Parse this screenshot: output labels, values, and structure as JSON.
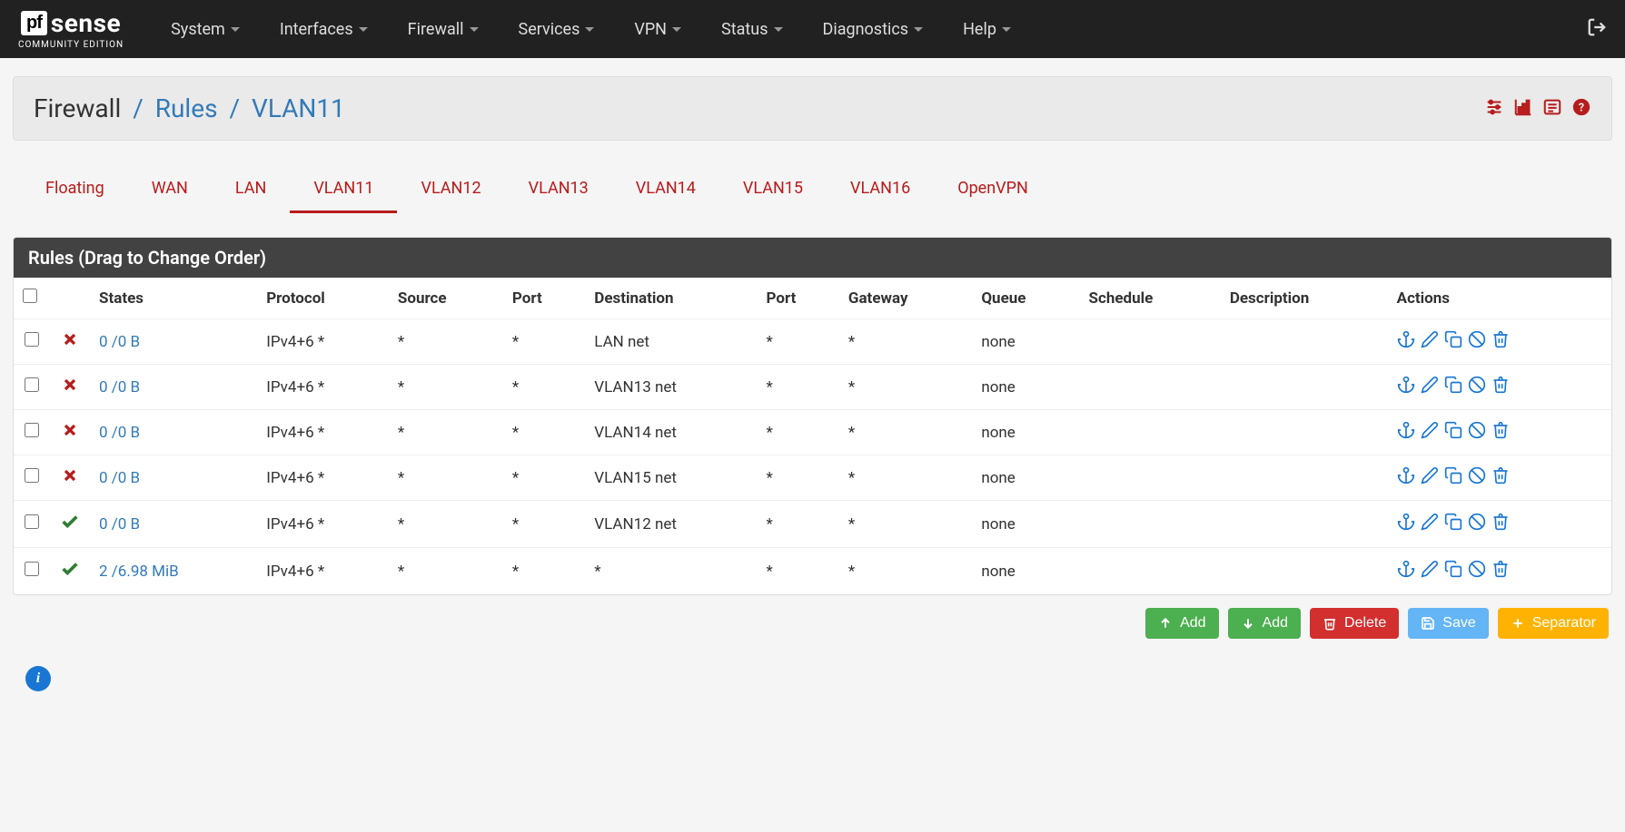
{
  "logo": {
    "brand_a": "pf",
    "brand_b": "sense",
    "edition": "COMMUNITY EDITION"
  },
  "nav": {
    "items": [
      "System",
      "Interfaces",
      "Firewall",
      "Services",
      "VPN",
      "Status",
      "Diagnostics",
      "Help"
    ]
  },
  "breadcrumb": {
    "a": "Firewall",
    "b": "Rules",
    "c": "VLAN11"
  },
  "tabs": {
    "items": [
      "Floating",
      "WAN",
      "LAN",
      "VLAN11",
      "VLAN12",
      "VLAN13",
      "VLAN14",
      "VLAN15",
      "VLAN16",
      "OpenVPN"
    ],
    "active_index": 3
  },
  "panel": {
    "title": "Rules (Drag to Change Order)"
  },
  "table": {
    "headers": [
      "",
      "",
      "States",
      "Protocol",
      "Source",
      "Port",
      "Destination",
      "Port",
      "Gateway",
      "Queue",
      "Schedule",
      "Description",
      "Actions"
    ],
    "rows": [
      {
        "action": "block",
        "states": "0 /0 B",
        "protocol": "IPv4+6 *",
        "source": "*",
        "sport": "*",
        "dest": "LAN net",
        "dport": "*",
        "gateway": "*",
        "queue": "none",
        "schedule": "",
        "description": ""
      },
      {
        "action": "block",
        "states": "0 /0 B",
        "protocol": "IPv4+6 *",
        "source": "*",
        "sport": "*",
        "dest": "VLAN13 net",
        "dport": "*",
        "gateway": "*",
        "queue": "none",
        "schedule": "",
        "description": ""
      },
      {
        "action": "block",
        "states": "0 /0 B",
        "protocol": "IPv4+6 *",
        "source": "*",
        "sport": "*",
        "dest": "VLAN14 net",
        "dport": "*",
        "gateway": "*",
        "queue": "none",
        "schedule": "",
        "description": ""
      },
      {
        "action": "block",
        "states": "0 /0 B",
        "protocol": "IPv4+6 *",
        "source": "*",
        "sport": "*",
        "dest": "VLAN15 net",
        "dport": "*",
        "gateway": "*",
        "queue": "none",
        "schedule": "",
        "description": ""
      },
      {
        "action": "pass",
        "states": "0 /0 B",
        "protocol": "IPv4+6 *",
        "source": "*",
        "sport": "*",
        "dest": "VLAN12 net",
        "dport": "*",
        "gateway": "*",
        "queue": "none",
        "schedule": "",
        "description": ""
      },
      {
        "action": "pass",
        "states": "2 /6.98 MiB",
        "protocol": "IPv4+6 *",
        "source": "*",
        "sport": "*",
        "dest": "*",
        "dport": "*",
        "gateway": "*",
        "queue": "none",
        "schedule": "",
        "description": ""
      }
    ]
  },
  "buttons": {
    "add_top": "Add",
    "add_bottom": "Add",
    "delete": "Delete",
    "save": "Save",
    "separator": "Separator"
  }
}
